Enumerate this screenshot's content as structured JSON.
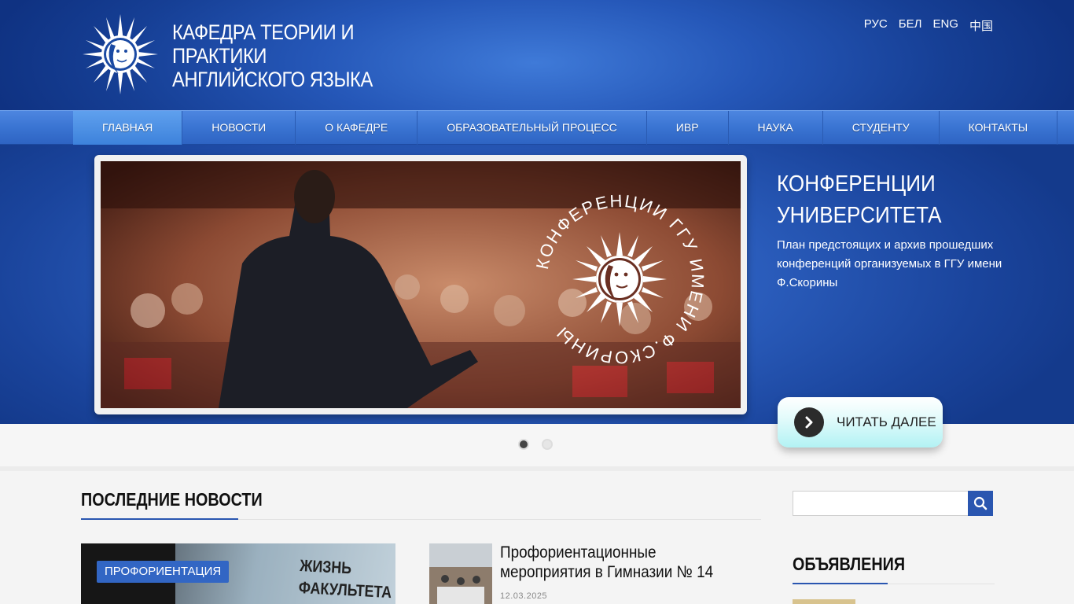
{
  "header": {
    "title": "Кафедра теории и практики английского языка",
    "languages": [
      "РУС",
      "БЕЛ",
      "ENG",
      "中国"
    ]
  },
  "nav": {
    "items": [
      "Главная",
      "Новости",
      "О кафедре",
      "Образовательный процесс",
      "ИВР",
      "Наука",
      "Студенту",
      "Контакты"
    ],
    "active": 0
  },
  "slider": {
    "image_text": "КОНФЕРЕНЦИИ ГГУ ИМЕНИ Ф.СКОРИНЫ",
    "title": "Конференции университета",
    "description": "План предстоящих и архив прошедших конференций организуемых в ГГУ имени Ф.Скорины",
    "button_label": "Читать далее",
    "slide_count": 2,
    "current": 0
  },
  "news": {
    "heading": "Последние новости",
    "featured_tag": "Профориентация",
    "featured_image_text": "Жизнь факультета",
    "item_title": "Профориентационные мероприятия в Гимназии № 14",
    "item_date": "12.03.2025"
  },
  "sidebar": {
    "search_placeholder": "",
    "ads_heading": "Объявления"
  },
  "colors": {
    "brand_blue": "#2a56b0",
    "nav_blue": "#3a74d2",
    "button_cyan": "#b2f2f4"
  },
  "icons": {
    "logo": "sun-moon-logo-icon",
    "read_more": "chevron-right-icon",
    "search": "search-icon"
  }
}
